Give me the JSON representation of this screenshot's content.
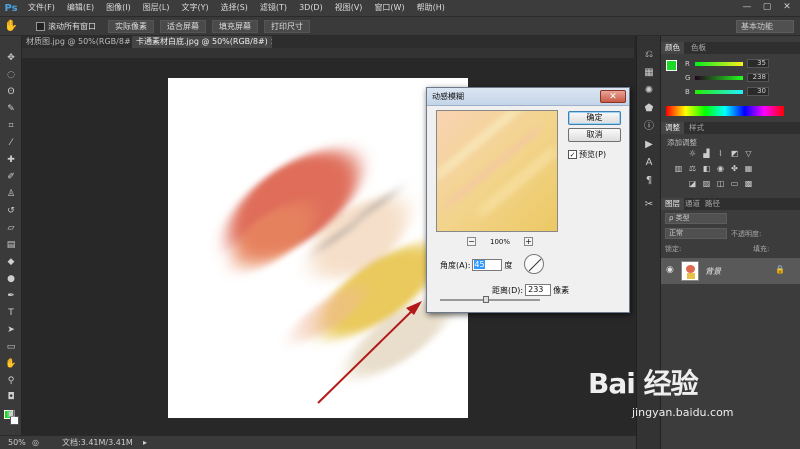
{
  "app": {
    "logo": "Ps"
  },
  "menu": [
    "文件(F)",
    "编辑(E)",
    "图像(I)",
    "图层(L)",
    "文字(Y)",
    "选择(S)",
    "滤镜(T)",
    "3D(D)",
    "视图(V)",
    "窗口(W)",
    "帮助(H)"
  ],
  "window_controls": [
    "—",
    "▢",
    "✕"
  ],
  "options_bar": {
    "scroll_all_label": "滚动所有窗口",
    "buttons": [
      "实际像素",
      "适合屏幕",
      "填充屏幕",
      "打印尺寸"
    ],
    "workspace": "基本功能"
  },
  "tabs": [
    {
      "label": "材质图.jpg @ 50%(RGB/8#) ×",
      "active": false
    },
    {
      "label": "卡通素材白底.jpg @ 50%(RGB/8#) ×",
      "active": true
    }
  ],
  "status": {
    "zoom": "50%",
    "doc": "文档:3.41M/3.41M"
  },
  "color_panel": {
    "tabs": [
      "颜色",
      "色板"
    ],
    "channels": [
      {
        "label": "R",
        "value": "35"
      },
      {
        "label": "G",
        "value": "238"
      },
      {
        "label": "B",
        "value": "30"
      }
    ]
  },
  "adjust_panel": {
    "tabs": [
      "调整",
      "样式"
    ],
    "title": "添加调整"
  },
  "layers_panel": {
    "tabs": [
      "图层",
      "通道",
      "路径"
    ],
    "filter": "ρ 类型",
    "blend_mode": "正常",
    "opacity_label": "不透明度:",
    "lock_label": "锁定:",
    "fill_label": "填充:",
    "layer_name": "背景"
  },
  "dialog": {
    "title": "动感模糊",
    "ok": "确定",
    "cancel": "取消",
    "preview_label": "预览(P)",
    "zoom": "100%",
    "angle_label": "角度(A):",
    "angle_value": "45",
    "angle_unit": "度",
    "distance_label": "距离(D):",
    "distance_value": "233",
    "distance_unit": "像素",
    "close": "✕"
  },
  "watermark": {
    "logo": "Bai 经验",
    "url": "jingyan.baidu.com"
  }
}
